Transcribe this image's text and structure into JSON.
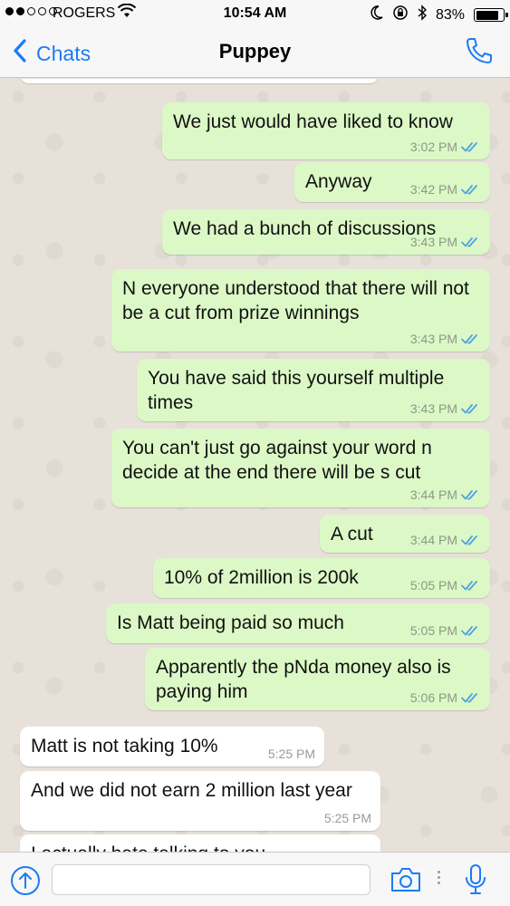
{
  "status": {
    "carrier": "ROGERS",
    "time": "10:54 AM",
    "battery_text": "83%",
    "battery_level": 0.83
  },
  "nav": {
    "back_label": "Chats",
    "title": "Puppey"
  },
  "messages": [
    {
      "dir": "out",
      "text": "We just would have liked to know",
      "time": "3:02 PM"
    },
    {
      "dir": "out",
      "text": "Anyway",
      "time": "3:42 PM"
    },
    {
      "dir": "out",
      "text": "We had a bunch of discussions",
      "time": "3:43 PM"
    },
    {
      "dir": "out",
      "text": "N everyone understood that there will not be a cut from prize winnings",
      "time": "3:43 PM"
    },
    {
      "dir": "out",
      "text": "You have said this yourself multiple times",
      "time": "3:43 PM"
    },
    {
      "dir": "out",
      "text": "You can't just go against your word n decide at the end there will be s cut",
      "time": "3:44 PM"
    },
    {
      "dir": "out",
      "text": "A cut",
      "time": "3:44 PM"
    },
    {
      "dir": "out",
      "text": "10% of 2million is 200k",
      "time": "5:05 PM"
    },
    {
      "dir": "out",
      "text": "Is Matt being paid so much",
      "time": "5:05 PM"
    },
    {
      "dir": "out",
      "text": "Apparently the pNda money also is paying him",
      "time": "5:06 PM"
    },
    {
      "dir": "in",
      "text": "Matt is not taking 10%",
      "time": "5:25 PM"
    },
    {
      "dir": "in",
      "text": "And we did not earn 2 million last year",
      "time": "5:25 PM"
    },
    {
      "dir": "in",
      "text": "I actually hate talking to you",
      "time": ""
    }
  ],
  "input": {
    "placeholder": ""
  },
  "icons": {
    "back": "chevron-left-icon",
    "call": "phone-icon",
    "upload": "upload-icon",
    "camera": "camera-icon",
    "mic": "microphone-icon"
  },
  "colors": {
    "accent": "#1a7cf5",
    "outgoing_bubble": "#dcf8c6",
    "incoming_bubble": "#ffffff",
    "read_ticks": "#4fa3e0"
  }
}
